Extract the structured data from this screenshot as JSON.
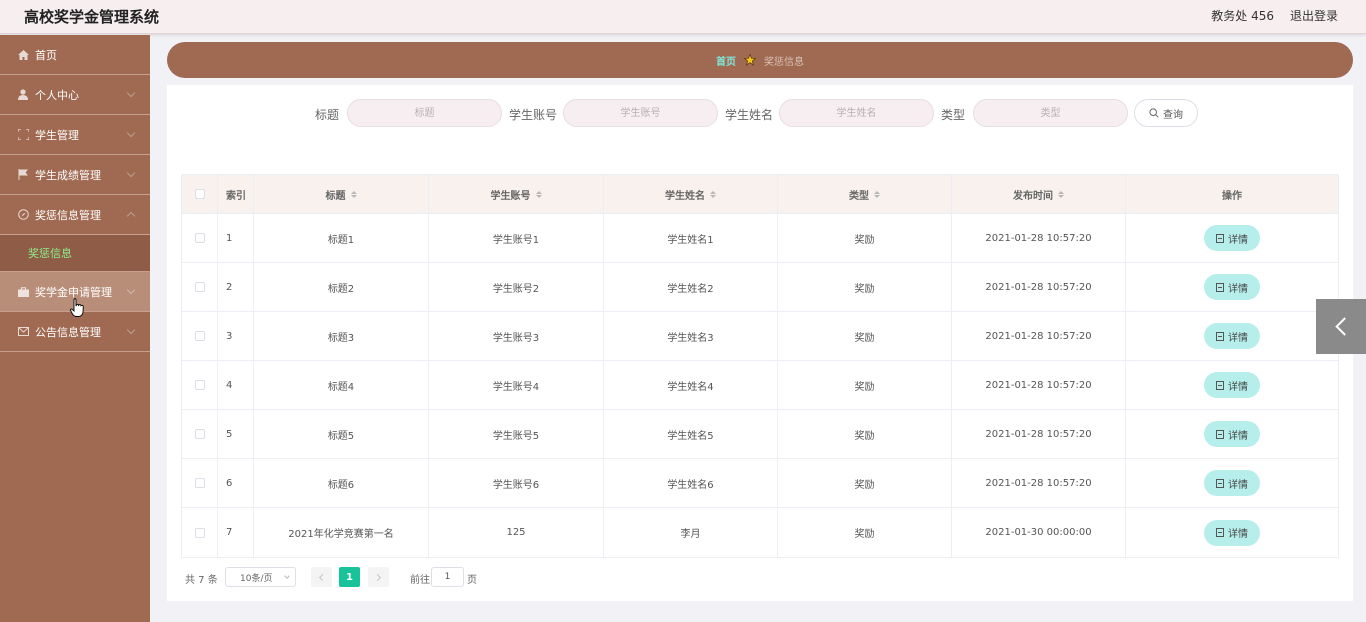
{
  "header": {
    "title": "高校奖学金管理系统",
    "user": "教务处 456",
    "logout": "退出登录"
  },
  "sidebar": {
    "items": [
      {
        "label": "首页",
        "icon": "home-icon"
      },
      {
        "label": "个人中心",
        "icon": "user-icon"
      },
      {
        "label": "学生管理",
        "icon": "frame-icon"
      },
      {
        "label": "学生成绩管理",
        "icon": "flag-icon"
      },
      {
        "label": "奖惩信息管理",
        "icon": "compass-icon"
      },
      {
        "label": "奖学金申请管理",
        "icon": "briefcase-icon"
      },
      {
        "label": "公告信息管理",
        "icon": "mail-icon"
      }
    ],
    "submenu": "奖惩信息"
  },
  "breadcrumb": {
    "home": "首页",
    "current": "奖惩信息"
  },
  "search": {
    "title_label": "标题",
    "title_placeholder": "标题",
    "account_label": "学生账号",
    "account_placeholder": "学生账号",
    "name_label": "学生姓名",
    "name_placeholder": "学生姓名",
    "type_label": "类型",
    "type_placeholder": "类型",
    "query_button": "查询"
  },
  "table": {
    "headers": {
      "index": "索引",
      "title": "标题",
      "account": "学生账号",
      "name": "学生姓名",
      "type": "类型",
      "time": "发布时间",
      "op": "操作"
    },
    "detail_label": "详情",
    "rows": [
      {
        "index": "1",
        "title": "标题1",
        "account": "学生账号1",
        "name": "学生姓名1",
        "type": "奖励",
        "time": "2021-01-28 10:57:20"
      },
      {
        "index": "2",
        "title": "标题2",
        "account": "学生账号2",
        "name": "学生姓名2",
        "type": "奖励",
        "time": "2021-01-28 10:57:20"
      },
      {
        "index": "3",
        "title": "标题3",
        "account": "学生账号3",
        "name": "学生姓名3",
        "type": "奖励",
        "time": "2021-01-28 10:57:20"
      },
      {
        "index": "4",
        "title": "标题4",
        "account": "学生账号4",
        "name": "学生姓名4",
        "type": "奖励",
        "time": "2021-01-28 10:57:20"
      },
      {
        "index": "5",
        "title": "标题5",
        "account": "学生账号5",
        "name": "学生姓名5",
        "type": "奖励",
        "time": "2021-01-28 10:57:20"
      },
      {
        "index": "6",
        "title": "标题6",
        "account": "学生账号6",
        "name": "学生姓名6",
        "type": "奖励",
        "time": "2021-01-28 10:57:20"
      },
      {
        "index": "7",
        "title": "2021年化学竞赛第一名",
        "account": "125",
        "name": "李月",
        "type": "奖励",
        "time": "2021-01-30 00:00:00"
      }
    ]
  },
  "pagination": {
    "total": "共 7 条",
    "page_size": "10条/页",
    "current": "1",
    "goto_label": "前往",
    "goto_value": "1",
    "page_suffix": "页"
  },
  "colors": {
    "brand": "#a06a52",
    "accent": "#19c39a",
    "detail_bg": "#b6eeeb",
    "submenu_active": "#8ef08a"
  }
}
